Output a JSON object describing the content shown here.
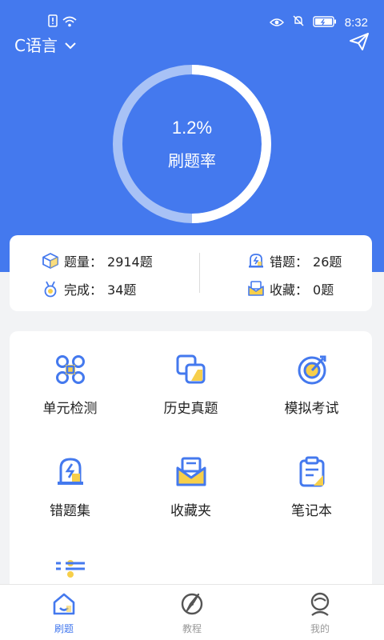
{
  "status_bar": {
    "time": "8:32",
    "icons": [
      "sim-alert-icon",
      "wifi-icon",
      "eye-icon",
      "mute-icon",
      "battery-icon"
    ]
  },
  "header": {
    "course": "C语言",
    "course_chevron": "chevron-down-icon",
    "action_icon": "send-icon"
  },
  "progress": {
    "rate_text": "1.2%",
    "label": "刷题率",
    "rate_fraction": 0.012
  },
  "stats": {
    "total": {
      "label": "题量：",
      "value": "2914题",
      "icon": "cube-icon"
    },
    "wrong": {
      "label": "错题：",
      "value": "26题",
      "icon": "lamp-icon"
    },
    "done": {
      "label": "完成：",
      "value": "34题",
      "icon": "medal-icon"
    },
    "fav": {
      "label": "收藏：",
      "value": "0题",
      "icon": "envelope-icon"
    }
  },
  "functions": [
    {
      "label": "单元检测",
      "icon": "unit-test-icon"
    },
    {
      "label": "历史真题",
      "icon": "past-papers-icon"
    },
    {
      "label": "模拟考试",
      "icon": "target-icon"
    },
    {
      "label": "错题集",
      "icon": "lamp-icon"
    },
    {
      "label": "收藏夹",
      "icon": "envelope-icon"
    },
    {
      "label": "笔记本",
      "icon": "clipboard-icon"
    },
    {
      "label": "",
      "icon": "settings-sliders-icon"
    }
  ],
  "bottom_nav": [
    {
      "label": "刷题",
      "icon": "home-icon",
      "active": true
    },
    {
      "label": "教程",
      "icon": "compass-icon",
      "active": false
    },
    {
      "label": "我的",
      "icon": "profile-icon",
      "active": false
    }
  ],
  "colors": {
    "primary": "#4479ee",
    "accent": "#f7cf4a",
    "background": "#f2f3f5"
  }
}
